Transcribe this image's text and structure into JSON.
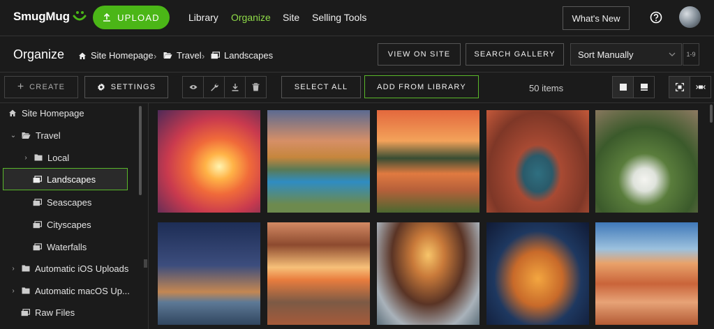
{
  "app": {
    "logo_text": "SmugMug",
    "upload_label": "UPLOAD",
    "nav": [
      {
        "label": "Library",
        "active": false
      },
      {
        "label": "Organize",
        "active": true
      },
      {
        "label": "Site",
        "active": false
      },
      {
        "label": "Selling Tools",
        "active": false
      }
    ],
    "whats_new_label": "What's New",
    "accent_color": "#4bb617",
    "active_nav_color": "#8fdb48"
  },
  "header": {
    "title": "Organize",
    "breadcrumb": [
      {
        "label": "Site Homepage",
        "icon": "home-icon"
      },
      {
        "label": "Travel",
        "icon": "folder-open-icon"
      },
      {
        "label": "Landscapes",
        "icon": "gallery-icon"
      }
    ],
    "view_on_site_label": "VIEW ON SITE",
    "search_gallery_label": "SEARCH GALLERY",
    "sort_value": "Sort Manually",
    "range_label": "1-9"
  },
  "toolbar": {
    "create_label": "CREATE",
    "settings_label": "SETTINGS",
    "select_all_label": "SELECT ALL",
    "add_from_library_label": "ADD FROM LIBRARY",
    "items_count": "50 items"
  },
  "sidebar": {
    "items": [
      {
        "label": "Site Homepage",
        "icon": "home-icon"
      },
      {
        "label": "Travel",
        "icon": "folder-open-icon"
      },
      {
        "label": "Local",
        "icon": "folder-icon"
      },
      {
        "label": "Landscapes",
        "icon": "gallery-icon",
        "selected": true
      },
      {
        "label": "Seascapes",
        "icon": "gallery-icon"
      },
      {
        "label": "Cityscapes",
        "icon": "gallery-icon"
      },
      {
        "label": "Waterfalls",
        "icon": "gallery-icon"
      },
      {
        "label": "Automatic iOS Uploads",
        "icon": "folder-icon"
      },
      {
        "label": "Automatic macOS Up...",
        "icon": "folder-icon"
      },
      {
        "label": "Raw Files",
        "icon": "gallery-icon"
      }
    ]
  },
  "photos": [
    {
      "subject": "lava-swirl"
    },
    {
      "subject": "mountain-lake-sunset"
    },
    {
      "subject": "pond-reflection-sunset"
    },
    {
      "subject": "horseshoe-bend"
    },
    {
      "subject": "calla-lilies-canyon"
    },
    {
      "subject": "milky-way-lake"
    },
    {
      "subject": "mesa-arch"
    },
    {
      "subject": "slot-canyon-river"
    },
    {
      "subject": "double-arch-night"
    },
    {
      "subject": "the-wave-sandstone"
    }
  ]
}
